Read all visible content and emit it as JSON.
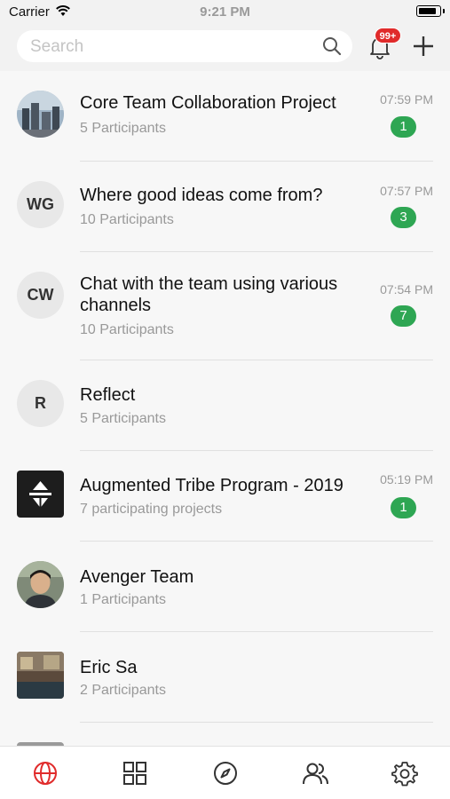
{
  "status_bar": {
    "carrier": "Carrier",
    "time": "9:21 PM"
  },
  "header": {
    "search_placeholder": "Search",
    "notification_badge": "99+"
  },
  "chats": [
    {
      "title": "Core Team Collaboration Project",
      "subtitle": "5 Participants",
      "time": "07:59 PM",
      "unread": "1",
      "avatar": "photo-building"
    },
    {
      "title": "Where good ideas come from?",
      "subtitle": "10 Participants",
      "time": "07:57 PM",
      "unread": "3",
      "avatar_initials": "WG"
    },
    {
      "title": "Chat with the team using various channels",
      "subtitle": "10 Participants",
      "time": "07:54 PM",
      "unread": "7",
      "avatar_initials": "CW"
    },
    {
      "title": "Reflect",
      "subtitle": "5 Participants",
      "avatar_initials": "R"
    },
    {
      "title": "Augmented Tribe Program - 2019",
      "subtitle": "7 participating projects",
      "time": "05:19 PM",
      "unread": "1",
      "avatar": "logo-tribe"
    },
    {
      "title": "Avenger Team",
      "subtitle": "1 Participants",
      "avatar": "photo-person"
    },
    {
      "title": "Eric Sa",
      "subtitle": "2 Participants",
      "avatar": "photo-room"
    }
  ],
  "tabbar": {
    "tabs": [
      "globe-icon",
      "grid-icon",
      "compass-icon",
      "people-icon",
      "gear-icon"
    ],
    "active_color": "#e02b2b",
    "inactive_color": "#333333"
  },
  "colors": {
    "unread_badge": "#2ea653",
    "notification_badge": "#e02b2b"
  }
}
